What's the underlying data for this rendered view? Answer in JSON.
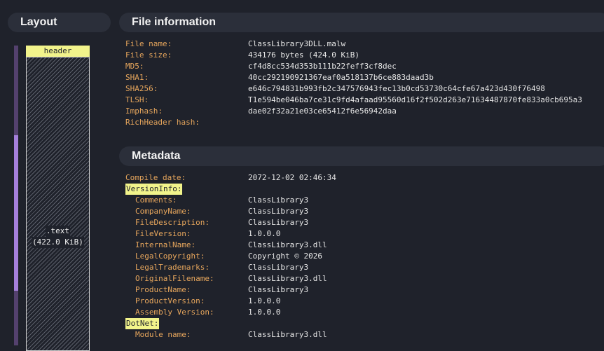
{
  "layout": {
    "title": "Layout",
    "header_label": "header",
    "text_section_name": ".text",
    "text_section_size": "(422.0 KiB)"
  },
  "file_info": {
    "title": "File information",
    "rows": [
      {
        "key": "File name:",
        "value": "ClassLibrary3DLL.malw"
      },
      {
        "key": "File size:",
        "value": "434176 bytes (424.0 KiB)"
      },
      {
        "key": "MD5:",
        "value": "cf4d8cc534d353b111b22feff3cf8dec"
      },
      {
        "key": "SHA1:",
        "value": "40cc292190921367eaf0a518137b6ce883daad3b"
      },
      {
        "key": "SHA256:",
        "value": "e646c794831b993fb2c347576943fec13b0cd53730c64cfe67a423d430f76498"
      },
      {
        "key": "TLSH:",
        "value": "T1e594be046ba7ce31c9fd4afaad95560d16f2f502d263e71634487870fe833a0cb695a3"
      },
      {
        "key": "Imphash:",
        "value": "dae02f32a21e03ce65412f6e56942daa"
      },
      {
        "key": "RichHeader hash:",
        "value": ""
      }
    ]
  },
  "metadata": {
    "title": "Metadata",
    "compile_date_label": "Compile date:",
    "compile_date": "2072-12-02 02:46:34",
    "version_info_label": "VersionInfo:",
    "version_info": [
      {
        "key": "Comments:",
        "value": "ClassLibrary3"
      },
      {
        "key": "CompanyName:",
        "value": "ClassLibrary3"
      },
      {
        "key": "FileDescription:",
        "value": "ClassLibrary3"
      },
      {
        "key": "FileVersion:",
        "value": "1.0.0.0"
      },
      {
        "key": "InternalName:",
        "value": "ClassLibrary3.dll"
      },
      {
        "key": "LegalCopyright:",
        "value": "Copyright ©  2026"
      },
      {
        "key": "LegalTrademarks:",
        "value": "ClassLibrary3"
      },
      {
        "key": "OriginalFilename:",
        "value": "ClassLibrary3.dll"
      },
      {
        "key": "ProductName:",
        "value": "ClassLibrary3"
      },
      {
        "key": "ProductVersion:",
        "value": "1.0.0.0"
      },
      {
        "key": "Assembly Version:",
        "value": "1.0.0.0"
      }
    ],
    "dotnet_label": "DotNet:",
    "dotnet": [
      {
        "key": "Module name:",
        "value": "ClassLibrary3.dll"
      }
    ]
  }
}
